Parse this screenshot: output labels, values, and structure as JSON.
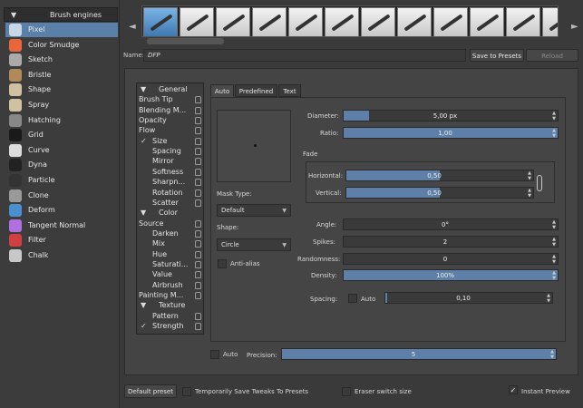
{
  "engines": {
    "header": "Brush engines",
    "items": [
      {
        "label": "Pixel",
        "icon": "pixel-brush-icon",
        "color": "#c9d6e6"
      },
      {
        "label": "Color Smudge",
        "icon": "color-smudge-icon",
        "color": "#e8663a"
      },
      {
        "label": "Sketch",
        "icon": "sketch-icon",
        "color": "#aaaaaa"
      },
      {
        "label": "Bristle",
        "icon": "bristle-icon",
        "color": "#b08a5a"
      },
      {
        "label": "Shape",
        "icon": "shape-icon",
        "color": "#d0c0a0"
      },
      {
        "label": "Spray",
        "icon": "spray-icon",
        "color": "#cfc2a0"
      },
      {
        "label": "Hatching",
        "icon": "hatching-icon",
        "color": "#888888"
      },
      {
        "label": "Grid",
        "icon": "grid-icon",
        "color": "#1a1a1a"
      },
      {
        "label": "Curve",
        "icon": "curve-icon",
        "color": "#dddddd"
      },
      {
        "label": "Dyna",
        "icon": "dyna-icon",
        "color": "#222222"
      },
      {
        "label": "Particle",
        "icon": "particle-icon",
        "color": "#333333"
      },
      {
        "label": "Clone",
        "icon": "clone-icon",
        "color": "#999999"
      },
      {
        "label": "Deform",
        "icon": "deform-icon",
        "color": "#4a8fd0"
      },
      {
        "label": "Tangent Normal",
        "icon": "tangent-normal-icon",
        "color": "#b070e0"
      },
      {
        "label": "Filter",
        "icon": "filter-icon",
        "color": "#d04040"
      },
      {
        "label": "Chalk",
        "icon": "chalk-icon",
        "color": "#c8c8c8"
      }
    ]
  },
  "presets": {
    "prev": "◄",
    "next": "►",
    "count": 12,
    "selected": 0
  },
  "name": {
    "label": "Name:",
    "value": "DFP"
  },
  "buttons": {
    "save": "Save to Presets",
    "reload": "Reload",
    "default_preset": "Default preset"
  },
  "options": [
    {
      "label": "General",
      "check": "▼",
      "indent": 1
    },
    {
      "label": "Brush Tip",
      "check": "",
      "indent": 0
    },
    {
      "label": "Blending M...",
      "check": "",
      "indent": 0
    },
    {
      "label": "Opacity",
      "check": "",
      "indent": 0
    },
    {
      "label": "Flow",
      "check": "",
      "indent": 0
    },
    {
      "label": "Size",
      "check": "✓",
      "indent": 1
    },
    {
      "label": "Spacing",
      "check": "",
      "indent": 1
    },
    {
      "label": "Mirror",
      "check": "",
      "indent": 1
    },
    {
      "label": "Softness",
      "check": "",
      "indent": 1
    },
    {
      "label": "Sharpn...",
      "check": "",
      "indent": 1
    },
    {
      "label": "Rotation",
      "check": "",
      "indent": 1
    },
    {
      "label": "Scatter",
      "check": "",
      "indent": 1
    },
    {
      "label": "Color",
      "check": "▼",
      "indent": 1
    },
    {
      "label": "Source",
      "check": "",
      "indent": 0
    },
    {
      "label": "Darken",
      "check": "",
      "indent": 1
    },
    {
      "label": "Mix",
      "check": "",
      "indent": 1
    },
    {
      "label": "Hue",
      "check": "",
      "indent": 1
    },
    {
      "label": "Saturati...",
      "check": "",
      "indent": 1
    },
    {
      "label": "Value",
      "check": "",
      "indent": 1
    },
    {
      "label": "Airbrush",
      "check": "",
      "indent": 1
    },
    {
      "label": "Painting M...",
      "check": "",
      "indent": 0
    },
    {
      "label": "Texture",
      "check": "▼",
      "indent": 1
    },
    {
      "label": "Pattern",
      "check": "",
      "indent": 1
    },
    {
      "label": "Strength",
      "check": "✓",
      "indent": 1
    }
  ],
  "tabs": [
    "Auto",
    "Predefined",
    "Text"
  ],
  "tip": {
    "mask_type_label": "Mask Type:",
    "mask_type_value": "Default",
    "shape_label": "Shape:",
    "shape_value": "Circle",
    "antialias_label": "Anti-alias",
    "diameter_label": "Diameter:",
    "diameter_value": "5,00 px",
    "diameter_fill": 0.12,
    "ratio_label": "Ratio:",
    "ratio_value": "1,00",
    "ratio_fill": 1.0,
    "fade_label": "Fade",
    "horizontal_label": "Horizontal:",
    "horizontal_value": "0,50",
    "horizontal_fill": 0.5,
    "vertical_label": "Vertical:",
    "vertical_value": "0,50",
    "vertical_fill": 0.5,
    "angle_label": "Angle:",
    "angle_value": "0°",
    "spikes_label": "Spikes:",
    "spikes_value": "2",
    "randomness_label": "Randomness:",
    "randomness_value": "0",
    "density_label": "Density:",
    "density_value": "100%",
    "density_fill": 1.0,
    "spacing_label": "Spacing:",
    "spacing_auto": "Auto",
    "spacing_value": "0,10",
    "spacing_fill": 0.01,
    "auto_label": "Auto",
    "precision_label": "Precision:",
    "precision_value": "5",
    "precision_fill": 1.0
  },
  "bottom": {
    "temp_save": "Temporarily Save Tweaks To Presets",
    "eraser": "Eraser switch size",
    "instant": "Instant Preview",
    "instant_check": "✓"
  }
}
